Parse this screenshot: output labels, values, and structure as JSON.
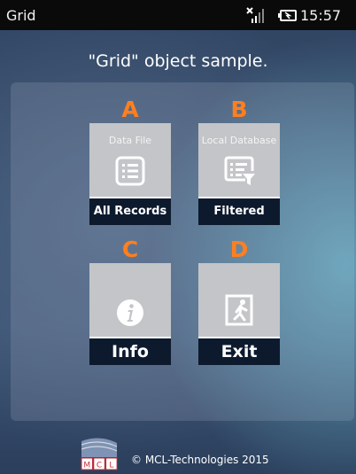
{
  "status_bar": {
    "app_title": "Grid",
    "time": "15:57",
    "icons": [
      "signal-icon",
      "battery-charging-icon"
    ]
  },
  "heading": "\"Grid\" object sample.",
  "tiles": [
    {
      "letter": "A",
      "caption": "Data File",
      "label": "All Records",
      "icon": "list-icon"
    },
    {
      "letter": "B",
      "caption": "Local Database",
      "label": "Filtered",
      "icon": "filter-list-icon"
    },
    {
      "letter": "C",
      "caption": "",
      "label": "Info",
      "icon": "info-icon"
    },
    {
      "letter": "D",
      "caption": "",
      "label": "Exit",
      "icon": "exit-icon"
    }
  ],
  "footer": {
    "logo_letters": [
      "M",
      "C",
      "L"
    ],
    "copyright": "© MCL-Technologies  2015"
  },
  "colors": {
    "accent_letter": "#ff7f1f",
    "tile_background": "#c3c5c8",
    "tile_label_background": "#0d1a2e",
    "status_bar": "#0a0a0a"
  }
}
